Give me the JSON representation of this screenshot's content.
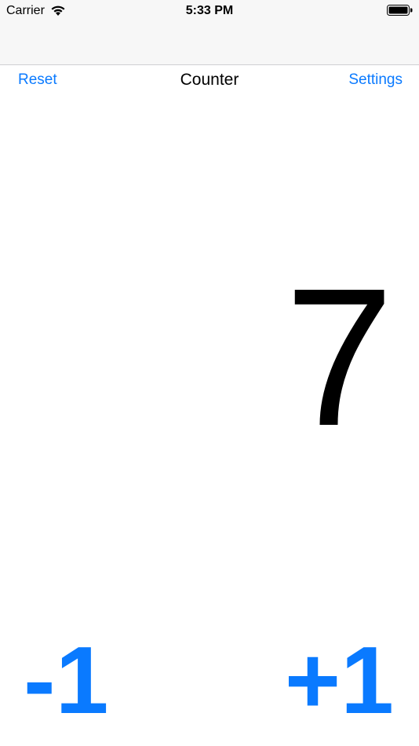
{
  "status_bar": {
    "carrier": "Carrier",
    "time": "5:33 PM",
    "wifi_icon": "wifi-icon",
    "battery_icon": "battery-icon"
  },
  "nav": {
    "left_label": "Reset",
    "title": "Counter",
    "right_label": "Settings"
  },
  "counter": {
    "value": "7"
  },
  "actions": {
    "decrement_label": "-1",
    "increment_label": "+1"
  },
  "colors": {
    "accent": "#0a7aff",
    "text": "#000000",
    "bar_background": "#f7f7f7"
  }
}
